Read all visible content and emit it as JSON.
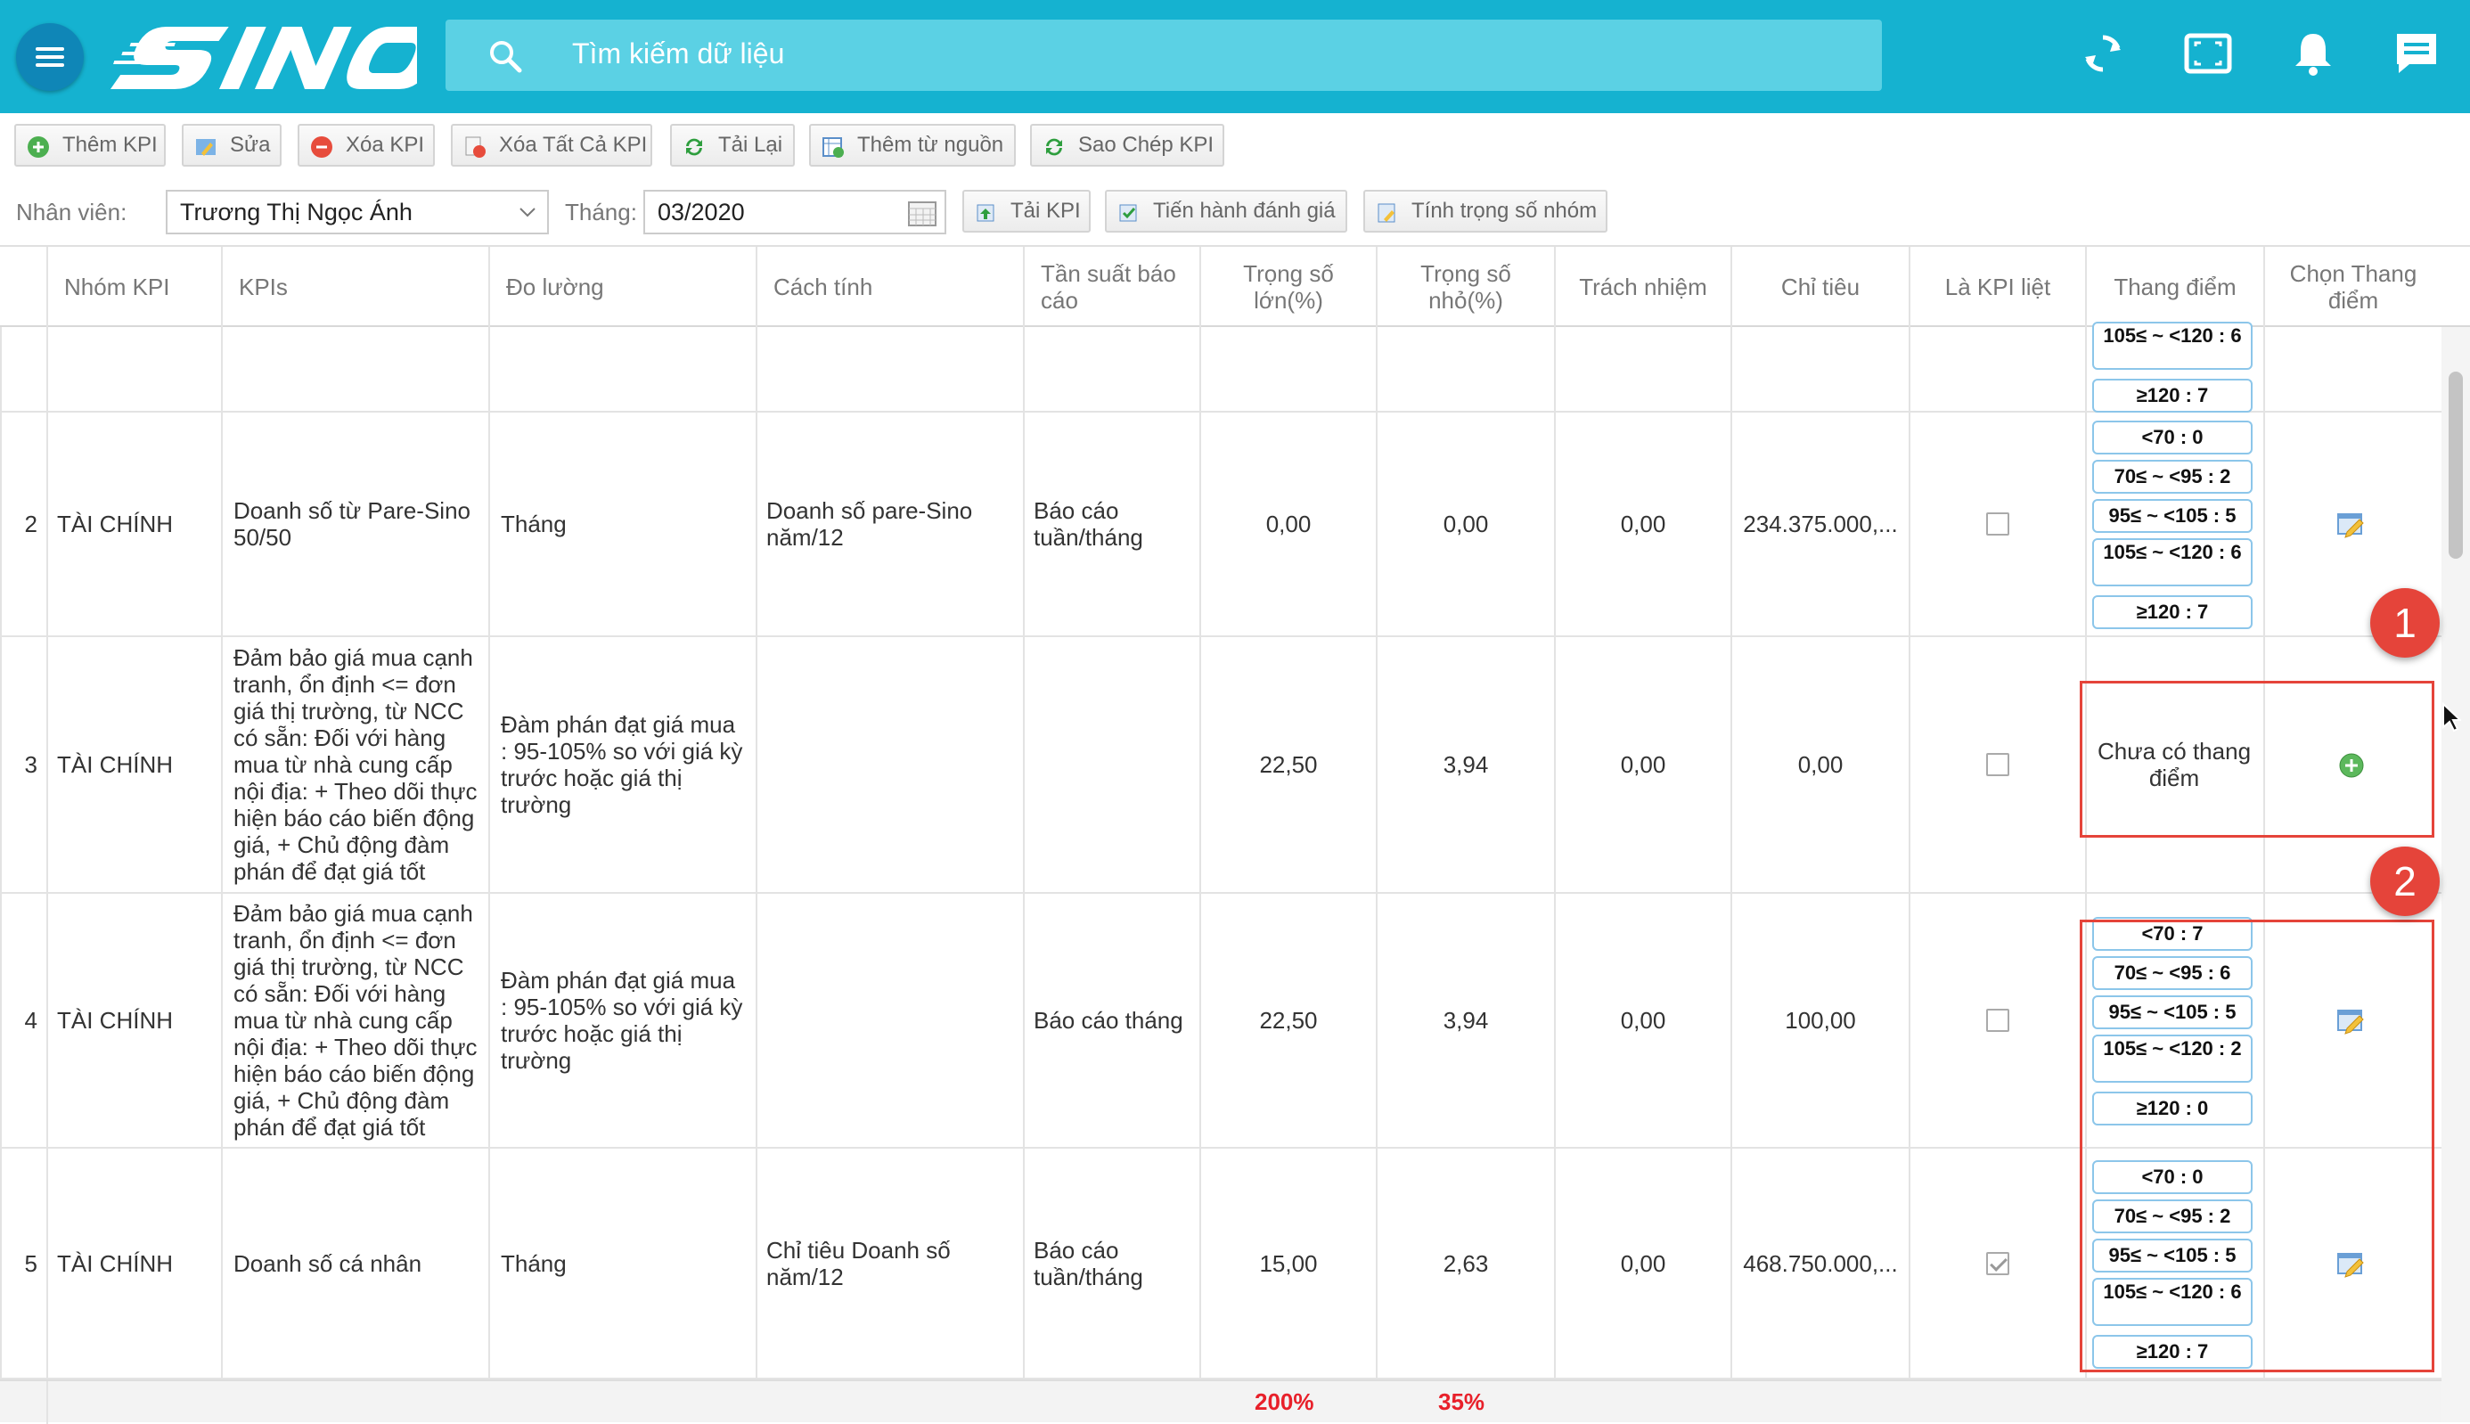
{
  "header": {
    "search_placeholder": "Tìm kiếm dữ liệu",
    "logo_text": "SINO"
  },
  "toolbar": {
    "add": "Thêm KPI",
    "edit": "Sửa",
    "delete": "Xóa KPI",
    "delete_all": "Xóa Tất Cả KPI",
    "reload": "Tải Lại",
    "add_from_source": "Thêm từ nguồn",
    "copy": "Sao Chép KPI"
  },
  "filter": {
    "employee_label": "Nhân viên:",
    "employee_value": "Trương Thị Ngọc Ánh",
    "month_label": "Tháng:",
    "month_value": "03/2020",
    "load_kpi": "Tải KPI",
    "evaluate": "Tiến hành đánh giá",
    "group_weight": "Tính trọng số nhóm"
  },
  "columns": {
    "group": "Nhóm KPI",
    "kpis": "KPIs",
    "measure": "Đo lường",
    "calc": "Cách tính",
    "freq": "Tần suất báo cáo",
    "weight_big": "Trọng số lớn(%)",
    "weight_small": "Trọng số nhỏ(%)",
    "resp": "Trách nhiệm",
    "target": "Chỉ tiêu",
    "is_kpi": "Là KPI liệt",
    "scale": "Thang điểm",
    "choose_scale": "Chọn Thang điểm"
  },
  "partial_row": {
    "scales": [
      "105≤ ~ <120 : 6",
      "≥120 : 7"
    ]
  },
  "rows": [
    {
      "no": "2",
      "group": "TÀI CHÍNH",
      "kpi": "Doanh số từ Pare-Sino 50/50",
      "measure": "Tháng",
      "calc": "Doanh số pare-Sino năm/12",
      "freq": "Báo cáo tuần/tháng",
      "wbig": "0,00",
      "wsmall": "0,00",
      "resp": "0,00",
      "target": "234.375.000,...",
      "is_kpi": false,
      "scales": [
        "<70 : 0",
        "70≤ ~ <95 : 2",
        "95≤ ~ <105 : 5",
        "105≤ ~ <120 : 6",
        "≥120 : 7"
      ]
    },
    {
      "no": "3",
      "group": "TÀI CHÍNH",
      "kpi": "Đảm bảo giá mua cạnh tranh, ổn định <= đơn giá thị trường, từ NCC có sẵn: Đối với hàng mua từ nhà cung cấp nội địa: + Theo dõi thực hiện báo cáo biến động giá, + Chủ động đàm phán để đạt giá tốt",
      "measure": "Đàm phán đạt giá mua : 95-105% so với giá kỳ trước hoặc giá thị trường",
      "calc": "",
      "freq": "",
      "wbig": "22,50",
      "wsmall": "3,94",
      "resp": "0,00",
      "target": "0,00",
      "is_kpi": false,
      "no_scale": "Chưa có thang điểm"
    },
    {
      "no": "4",
      "group": "TÀI CHÍNH",
      "kpi": "Đảm bảo giá mua cạnh tranh, ổn định <= đơn giá thị trường, từ NCC có sẵn: Đối với hàng mua từ nhà cung cấp nội địa: + Theo dõi thực hiện báo cáo biến động giá, + Chủ động đàm phán để đạt giá tốt",
      "measure": "Đàm phán đạt giá mua : 95-105% so với giá kỳ trước hoặc giá thị trường",
      "calc": "",
      "freq": "Báo cáo tháng",
      "wbig": "22,50",
      "wsmall": "3,94",
      "resp": "0,00",
      "target": "100,00",
      "is_kpi": false,
      "scales": [
        "<70 : 7",
        "70≤ ~ <95 : 6",
        "95≤ ~ <105 : 5",
        "105≤ ~ <120 : 2",
        "≥120 : 0"
      ]
    },
    {
      "no": "5",
      "group": "TÀI CHÍNH",
      "kpi": "Doanh số cá nhân",
      "measure": "Tháng",
      "calc": "Chỉ tiêu Doanh số năm/12",
      "freq": "Báo cáo tuần/tháng",
      "wbig": "15,00",
      "wsmall": "2,63",
      "resp": "0,00",
      "target": "468.750.000,...",
      "is_kpi": true,
      "scales": [
        "<70 : 0",
        "70≤ ~ <95 : 2",
        "95≤ ~ <105 : 5",
        "105≤ ~ <120 : 6",
        "≥120 : 7"
      ]
    }
  ],
  "totals": {
    "weight_big": "200%",
    "weight_small": "35%"
  },
  "annotations": {
    "marker1": "1",
    "marker2": "2"
  },
  "colors": {
    "header": "#15b2d0",
    "search": "#5bd1e4",
    "accent_red": "#e5443a",
    "total_red": "#e8202a"
  }
}
